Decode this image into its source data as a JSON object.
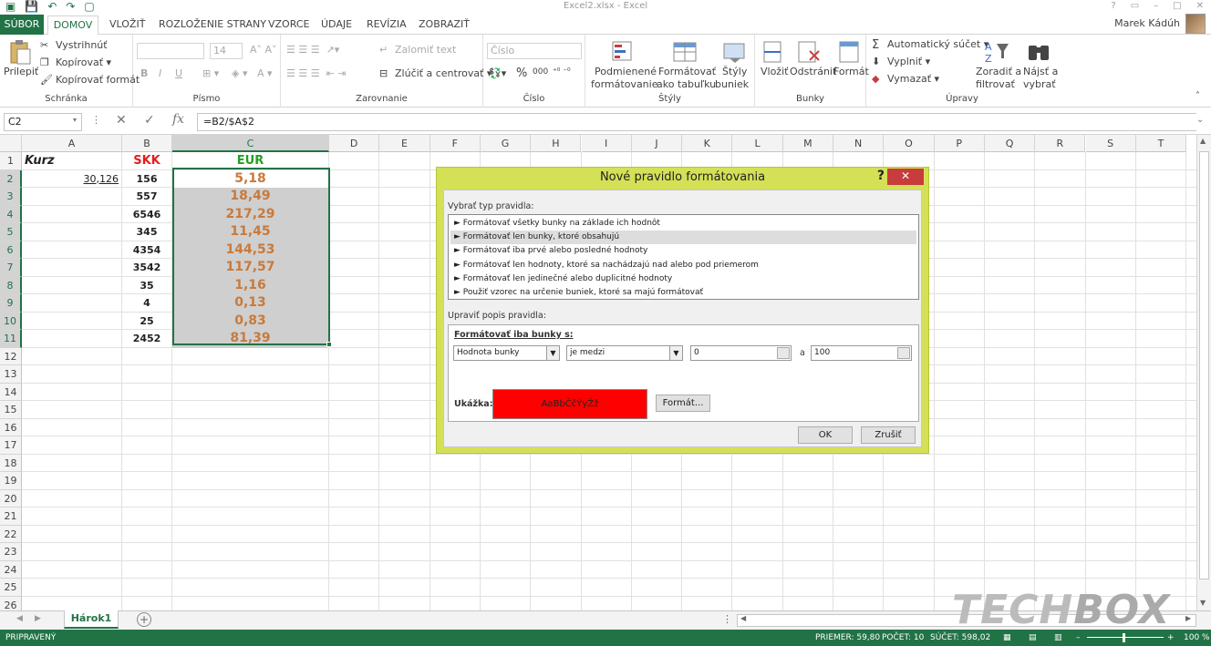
{
  "window": {
    "title": "Excel2.xlsx - Excel",
    "user": "Marek Kádúh"
  },
  "tabs": [
    "SÚBOR",
    "DOMOV",
    "VLOŽIŤ",
    "ROZLOŽENIE STRANY",
    "VZORCE",
    "ÚDAJE",
    "REVÍZIA",
    "ZOBRAZIŤ"
  ],
  "ribbon": {
    "clipboard": {
      "paste": "Prilepiť",
      "cut": "Vystrihnúť",
      "copy": "Kopírovať",
      "format_painter": "Kopírovať formát",
      "label": "Schránka"
    },
    "font": {
      "size": "14",
      "bold": "B",
      "italic": "I",
      "underline": "U",
      "label": "Písmo"
    },
    "alignment": {
      "wrap": "Zalomiť text",
      "merge": "Zlúčiť a centrovať",
      "label": "Zarovnanie"
    },
    "number": {
      "format": "Číslo",
      "percent": "%",
      "thousands": "000",
      "label": "Číslo"
    },
    "styles": {
      "cond1": "Podmienené",
      "cond2": "formátovanie",
      "table1": "Formátovať",
      "table2": "ako tabuľku",
      "cell1": "Štýly",
      "cell2": "buniek",
      "label": "Štýly"
    },
    "cells": {
      "insert": "Vložiť",
      "delete": "Odstrániť",
      "format": "Formát",
      "label": "Bunky"
    },
    "editing": {
      "autosum": "Automatický súčet",
      "fill": "Vyplniť",
      "clear": "Vymazať",
      "sort1": "Zoradiť a",
      "sort2": "filtrovať",
      "find1": "Nájsť a",
      "find2": "vybrať",
      "label": "Úpravy"
    }
  },
  "formula_bar": {
    "name_box": "C2",
    "fx": "fx",
    "formula": "=B2/$A$2"
  },
  "columns": [
    "A",
    "B",
    "C",
    "D",
    "E",
    "F",
    "G",
    "H",
    "I",
    "J",
    "K",
    "L",
    "M",
    "N",
    "O",
    "P",
    "Q",
    "R",
    "S",
    "T"
  ],
  "rows": [
    "1",
    "2",
    "3",
    "4",
    "5",
    "6",
    "7",
    "8",
    "9",
    "10",
    "11",
    "12",
    "13",
    "14",
    "15",
    "16",
    "17",
    "18",
    "19",
    "20",
    "21",
    "22",
    "23",
    "24",
    "25",
    "26"
  ],
  "cells": {
    "a1": "Kurz",
    "b1": "SKK",
    "c1": "EUR",
    "a2": "30,126",
    "skk": [
      "156",
      "557",
      "6546",
      "345",
      "4354",
      "3542",
      "35",
      "4",
      "25",
      "2452"
    ],
    "eur": [
      "5,18",
      "18,49",
      "217,29",
      "11,45",
      "144,53",
      "117,57",
      "1,16",
      "0,13",
      "0,83",
      "81,39"
    ]
  },
  "dialog": {
    "title": "Nové pravidlo formátovania",
    "help": "?",
    "close": "✕",
    "select_type_label": "Vybrať typ pravidla:",
    "rule_types": [
      "► Formátovať všetky bunky na základe ich hodnôt",
      "► Formátovať len bunky, ktoré obsahujú",
      "► Formátovať iba prvé alebo posledné hodnoty",
      "► Formátovať len hodnoty, ktoré sa nachádzajú nad alebo pod priemerom",
      "► Formátovať len jedinečné alebo duplicitné hodnoty",
      "► Použiť vzorec na určenie buniek, ktoré sa majú formátovať"
    ],
    "edit_label": "Upraviť popis pravidla:",
    "format_only_label": "Formátovať iba bunky s:",
    "cond_field": "Hodnota bunky",
    "cond_op": "je medzi",
    "value1": "0",
    "and_label": "a",
    "value2": "100",
    "preview_label": "Ukážka:",
    "preview_text": "AaBbČčÝyŽž",
    "format_button": "Formát...",
    "ok": "OK",
    "cancel": "Zrušiť"
  },
  "sheet_tab": "Hárok1",
  "status": {
    "ready": "PRIPRAVENÝ",
    "avg": "PRIEMER: 59,80",
    "count": "POČET: 10",
    "sum": "SÚČET: 598,02",
    "zoom": "100 %"
  },
  "watermark": {
    "a": "TECH",
    "b": "BOX"
  },
  "colors": {
    "accent": "#217346",
    "dialog_frame": "#d4e157",
    "eur_text": "#c87a3c",
    "skk_header": "#e02020",
    "eur_header": "#22a022",
    "preview_fill": "#ff0000"
  }
}
